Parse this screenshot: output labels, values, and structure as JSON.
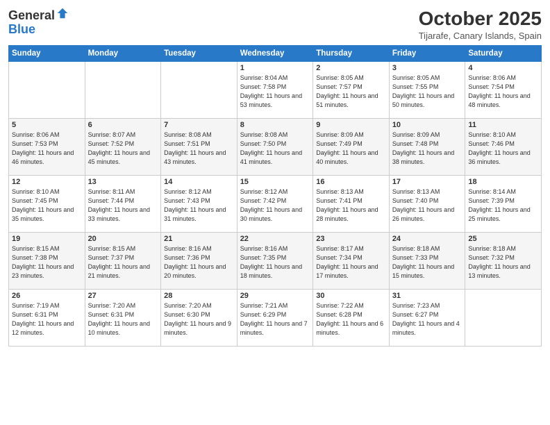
{
  "logo": {
    "general": "General",
    "blue": "Blue"
  },
  "header": {
    "month": "October 2025",
    "location": "Tijarafe, Canary Islands, Spain"
  },
  "weekdays": [
    "Sunday",
    "Monday",
    "Tuesday",
    "Wednesday",
    "Thursday",
    "Friday",
    "Saturday"
  ],
  "weeks": [
    [
      {
        "day": "",
        "sunrise": "",
        "sunset": "",
        "daylight": ""
      },
      {
        "day": "",
        "sunrise": "",
        "sunset": "",
        "daylight": ""
      },
      {
        "day": "",
        "sunrise": "",
        "sunset": "",
        "daylight": ""
      },
      {
        "day": "1",
        "sunrise": "Sunrise: 8:04 AM",
        "sunset": "Sunset: 7:58 PM",
        "daylight": "Daylight: 11 hours and 53 minutes."
      },
      {
        "day": "2",
        "sunrise": "Sunrise: 8:05 AM",
        "sunset": "Sunset: 7:57 PM",
        "daylight": "Daylight: 11 hours and 51 minutes."
      },
      {
        "day": "3",
        "sunrise": "Sunrise: 8:05 AM",
        "sunset": "Sunset: 7:55 PM",
        "daylight": "Daylight: 11 hours and 50 minutes."
      },
      {
        "day": "4",
        "sunrise": "Sunrise: 8:06 AM",
        "sunset": "Sunset: 7:54 PM",
        "daylight": "Daylight: 11 hours and 48 minutes."
      }
    ],
    [
      {
        "day": "5",
        "sunrise": "Sunrise: 8:06 AM",
        "sunset": "Sunset: 7:53 PM",
        "daylight": "Daylight: 11 hours and 46 minutes."
      },
      {
        "day": "6",
        "sunrise": "Sunrise: 8:07 AM",
        "sunset": "Sunset: 7:52 PM",
        "daylight": "Daylight: 11 hours and 45 minutes."
      },
      {
        "day": "7",
        "sunrise": "Sunrise: 8:08 AM",
        "sunset": "Sunset: 7:51 PM",
        "daylight": "Daylight: 11 hours and 43 minutes."
      },
      {
        "day": "8",
        "sunrise": "Sunrise: 8:08 AM",
        "sunset": "Sunset: 7:50 PM",
        "daylight": "Daylight: 11 hours and 41 minutes."
      },
      {
        "day": "9",
        "sunrise": "Sunrise: 8:09 AM",
        "sunset": "Sunset: 7:49 PM",
        "daylight": "Daylight: 11 hours and 40 minutes."
      },
      {
        "day": "10",
        "sunrise": "Sunrise: 8:09 AM",
        "sunset": "Sunset: 7:48 PM",
        "daylight": "Daylight: 11 hours and 38 minutes."
      },
      {
        "day": "11",
        "sunrise": "Sunrise: 8:10 AM",
        "sunset": "Sunset: 7:46 PM",
        "daylight": "Daylight: 11 hours and 36 minutes."
      }
    ],
    [
      {
        "day": "12",
        "sunrise": "Sunrise: 8:10 AM",
        "sunset": "Sunset: 7:45 PM",
        "daylight": "Daylight: 11 hours and 35 minutes."
      },
      {
        "day": "13",
        "sunrise": "Sunrise: 8:11 AM",
        "sunset": "Sunset: 7:44 PM",
        "daylight": "Daylight: 11 hours and 33 minutes."
      },
      {
        "day": "14",
        "sunrise": "Sunrise: 8:12 AM",
        "sunset": "Sunset: 7:43 PM",
        "daylight": "Daylight: 11 hours and 31 minutes."
      },
      {
        "day": "15",
        "sunrise": "Sunrise: 8:12 AM",
        "sunset": "Sunset: 7:42 PM",
        "daylight": "Daylight: 11 hours and 30 minutes."
      },
      {
        "day": "16",
        "sunrise": "Sunrise: 8:13 AM",
        "sunset": "Sunset: 7:41 PM",
        "daylight": "Daylight: 11 hours and 28 minutes."
      },
      {
        "day": "17",
        "sunrise": "Sunrise: 8:13 AM",
        "sunset": "Sunset: 7:40 PM",
        "daylight": "Daylight: 11 hours and 26 minutes."
      },
      {
        "day": "18",
        "sunrise": "Sunrise: 8:14 AM",
        "sunset": "Sunset: 7:39 PM",
        "daylight": "Daylight: 11 hours and 25 minutes."
      }
    ],
    [
      {
        "day": "19",
        "sunrise": "Sunrise: 8:15 AM",
        "sunset": "Sunset: 7:38 PM",
        "daylight": "Daylight: 11 hours and 23 minutes."
      },
      {
        "day": "20",
        "sunrise": "Sunrise: 8:15 AM",
        "sunset": "Sunset: 7:37 PM",
        "daylight": "Daylight: 11 hours and 21 minutes."
      },
      {
        "day": "21",
        "sunrise": "Sunrise: 8:16 AM",
        "sunset": "Sunset: 7:36 PM",
        "daylight": "Daylight: 11 hours and 20 minutes."
      },
      {
        "day": "22",
        "sunrise": "Sunrise: 8:16 AM",
        "sunset": "Sunset: 7:35 PM",
        "daylight": "Daylight: 11 hours and 18 minutes."
      },
      {
        "day": "23",
        "sunrise": "Sunrise: 8:17 AM",
        "sunset": "Sunset: 7:34 PM",
        "daylight": "Daylight: 11 hours and 17 minutes."
      },
      {
        "day": "24",
        "sunrise": "Sunrise: 8:18 AM",
        "sunset": "Sunset: 7:33 PM",
        "daylight": "Daylight: 11 hours and 15 minutes."
      },
      {
        "day": "25",
        "sunrise": "Sunrise: 8:18 AM",
        "sunset": "Sunset: 7:32 PM",
        "daylight": "Daylight: 11 hours and 13 minutes."
      }
    ],
    [
      {
        "day": "26",
        "sunrise": "Sunrise: 7:19 AM",
        "sunset": "Sunset: 6:31 PM",
        "daylight": "Daylight: 11 hours and 12 minutes."
      },
      {
        "day": "27",
        "sunrise": "Sunrise: 7:20 AM",
        "sunset": "Sunset: 6:31 PM",
        "daylight": "Daylight: 11 hours and 10 minutes."
      },
      {
        "day": "28",
        "sunrise": "Sunrise: 7:20 AM",
        "sunset": "Sunset: 6:30 PM",
        "daylight": "Daylight: 11 hours and 9 minutes."
      },
      {
        "day": "29",
        "sunrise": "Sunrise: 7:21 AM",
        "sunset": "Sunset: 6:29 PM",
        "daylight": "Daylight: 11 hours and 7 minutes."
      },
      {
        "day": "30",
        "sunrise": "Sunrise: 7:22 AM",
        "sunset": "Sunset: 6:28 PM",
        "daylight": "Daylight: 11 hours and 6 minutes."
      },
      {
        "day": "31",
        "sunrise": "Sunrise: 7:23 AM",
        "sunset": "Sunset: 6:27 PM",
        "daylight": "Daylight: 11 hours and 4 minutes."
      },
      {
        "day": "",
        "sunrise": "",
        "sunset": "",
        "daylight": ""
      }
    ]
  ]
}
